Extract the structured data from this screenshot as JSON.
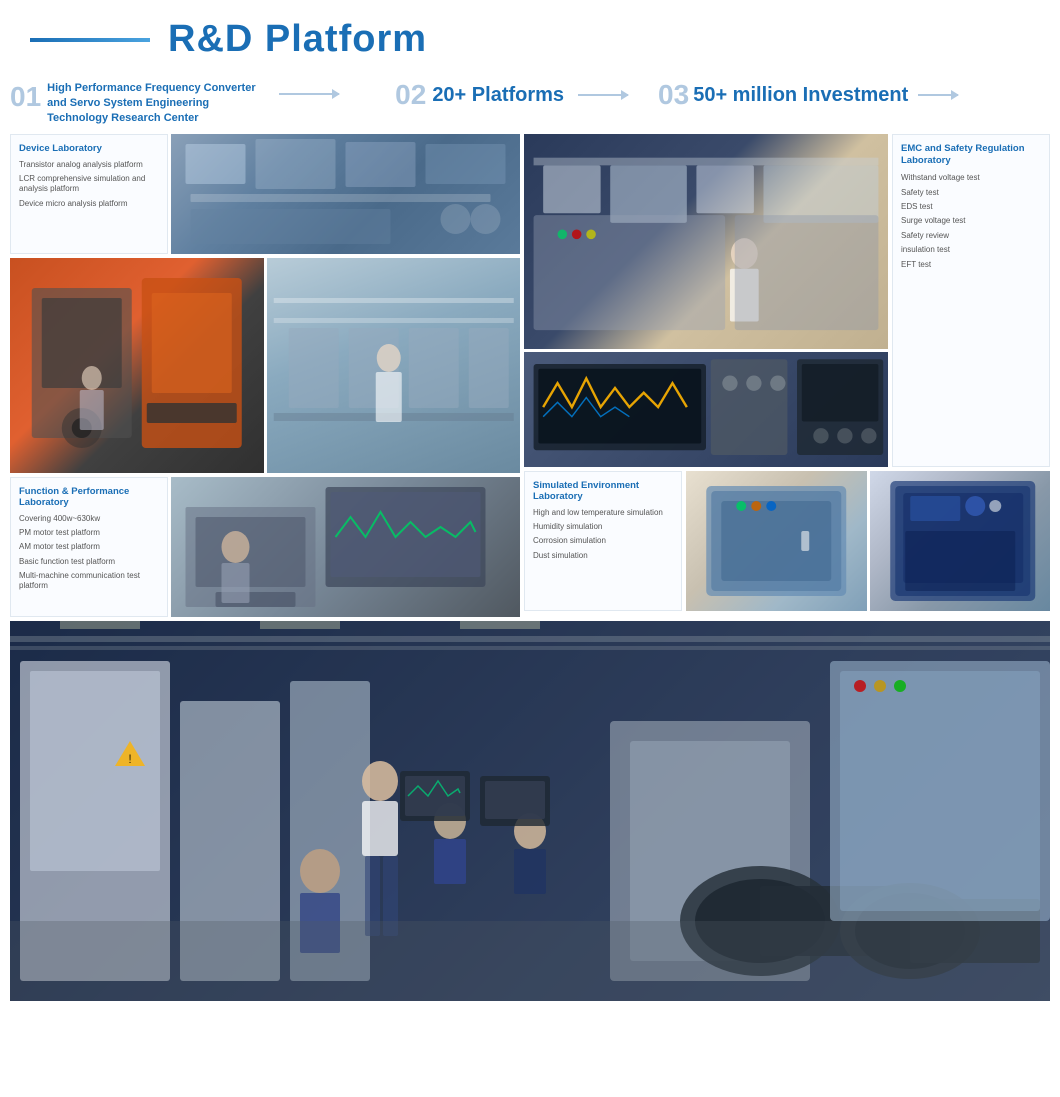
{
  "header": {
    "title": "R&D Platform",
    "line_decoration": true
  },
  "sections": {
    "s1": {
      "num": "01",
      "text": "High Performance Frequency Converter and Servo System Engineering Technology Research Center"
    },
    "s2": {
      "num": "02",
      "text": "20+ Platforms"
    },
    "s3": {
      "num": "03",
      "text": "50+ million Investment"
    }
  },
  "device_lab": {
    "title": "Device Laboratory",
    "items": [
      "Transistor analog analysis platform",
      "LCR comprehensive simulation and analysis platform",
      "Device micro analysis platform"
    ]
  },
  "emc_lab": {
    "title": "EMC and Safety Regulation Laboratory",
    "items": [
      "Withstand voltage test",
      "Safety test",
      "EDS test",
      "Surge voltage test",
      "Safety review",
      "insulation test",
      "EFT test"
    ]
  },
  "func_lab": {
    "title": "Function & Performance Laboratory",
    "items": [
      "Covering 400w~630kw",
      "PM motor test platform",
      "AM motor test platform",
      "Basic function test platform",
      "Multi-machine communication test platform"
    ]
  },
  "sim_lab": {
    "title": "Simulated Environment Laboratory",
    "items": [
      "High and low temperature simulation",
      "Humidity simulation",
      "Corrosion simulation",
      "Dust simulation"
    ]
  }
}
